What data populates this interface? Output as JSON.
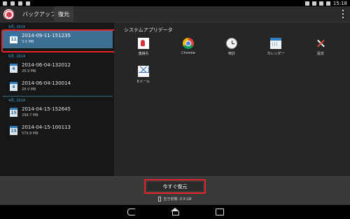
{
  "status": {
    "time": "15:18"
  },
  "tabs": {
    "backup": "バックアップ",
    "restore": "復元"
  },
  "backups": {
    "groups": [
      {
        "month": "9月, 2014",
        "items": [
          {
            "day": "11",
            "name": "2014-09-11-151235",
            "size": "3.5 MB",
            "selected": true
          }
        ]
      },
      {
        "month": "6月, 2014",
        "items": [
          {
            "day": "4",
            "name": "2014-06-04-132012",
            "size": "28.9 MB"
          },
          {
            "day": "4",
            "name": "2014-06-04-130014",
            "size": "28.9 MB"
          }
        ]
      },
      {
        "month": "4月, 2014",
        "items": [
          {
            "day": "15",
            "name": "2014-04-15-152645",
            "size": "298.7 MB"
          },
          {
            "day": "15",
            "name": "2014-04-15-100113",
            "size": "579.8 MB"
          }
        ]
      }
    ]
  },
  "content": {
    "section_title": "システムアプリデータ",
    "apps": [
      {
        "label": "連絡先",
        "icon": "contacts-icon"
      },
      {
        "label": "Chrome",
        "icon": "chrome-icon"
      },
      {
        "label": "時計",
        "icon": "clock-icon"
      },
      {
        "label": "カレンダー",
        "icon": "calendar-icon"
      },
      {
        "label": "設定",
        "icon": "settings-icon"
      },
      {
        "label": "Eメール",
        "icon": "email-icon"
      }
    ]
  },
  "footer": {
    "restore_now": "今すぐ復元",
    "free_space": "空き容量: 9.9 GB"
  },
  "colors": {
    "accent": "#3fa8df",
    "selected": "#3d6e94",
    "highlight": "#e5242b"
  }
}
